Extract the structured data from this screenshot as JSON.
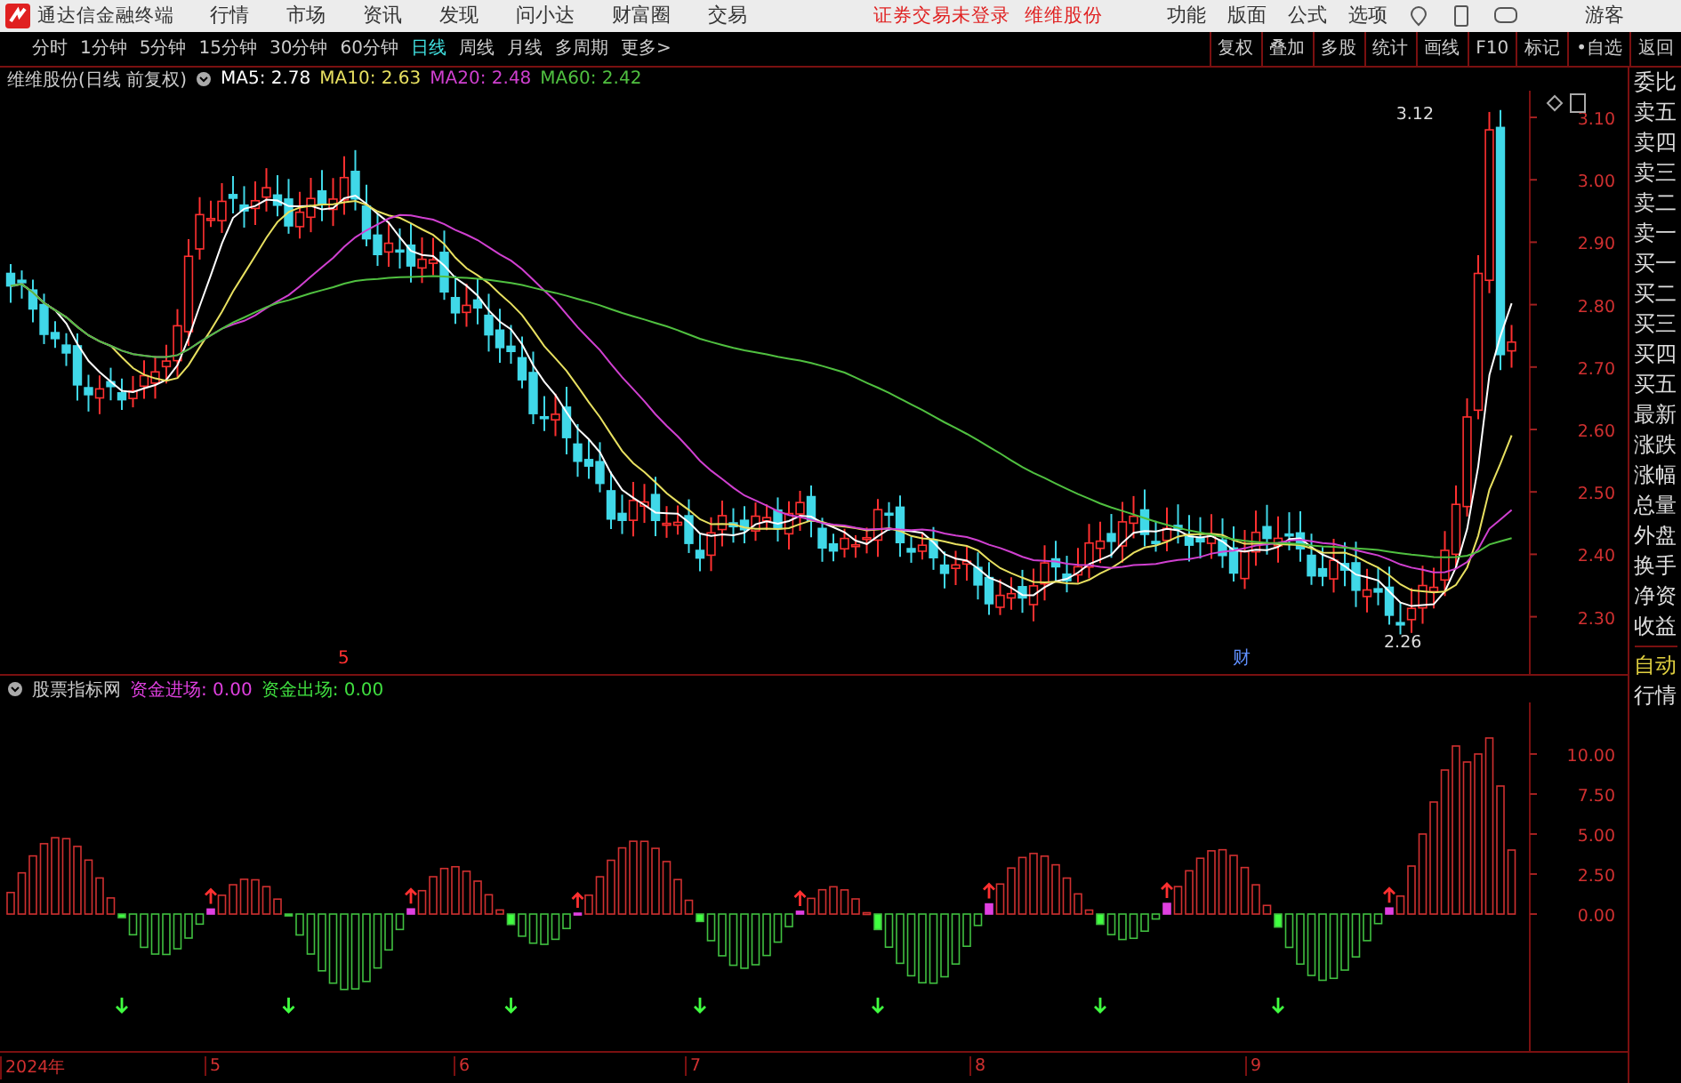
{
  "menu_bar": {
    "app_title": "通达信金融终端",
    "menus": [
      "行情",
      "市场",
      "资讯",
      "发现",
      "问小达",
      "财富圈",
      "交易"
    ],
    "notice": "证券交易未登录",
    "stock": "维维股份",
    "right_menus": [
      "功能",
      "版面",
      "公式",
      "选项"
    ],
    "user": "游客"
  },
  "toolbar": {
    "periods": [
      {
        "label": "分时",
        "selected": false
      },
      {
        "label": "1分钟",
        "selected": false
      },
      {
        "label": "5分钟",
        "selected": false
      },
      {
        "label": "15分钟",
        "selected": false
      },
      {
        "label": "30分钟",
        "selected": false
      },
      {
        "label": "60分钟",
        "selected": false
      },
      {
        "label": "日线",
        "selected": true
      },
      {
        "label": "周线",
        "selected": false
      },
      {
        "label": "月线",
        "selected": false
      },
      {
        "label": "多周期",
        "selected": false
      },
      {
        "label": "更多>",
        "selected": false
      }
    ],
    "tools": [
      "复权",
      "叠加",
      "多股",
      "统计",
      "画线",
      "F10",
      "标记",
      "•自选",
      "返回"
    ]
  },
  "main_chart": {
    "title": "维维股份(日线 前复权)",
    "ma": [
      {
        "label": "MA5: 2.78",
        "color": "#ffffff"
      },
      {
        "label": "MA10: 2.63",
        "color": "#e8e060"
      },
      {
        "label": "MA20: 2.48",
        "color": "#d040d0"
      },
      {
        "label": "MA60: 2.42",
        "color": "#50c040"
      }
    ],
    "price_ticks": [
      "3.10",
      "3.00",
      "2.90",
      "2.80",
      "2.70",
      "2.60",
      "2.50",
      "2.40",
      "2.30"
    ],
    "high_label": "3.12",
    "low_label": "2.26",
    "markers": [
      {
        "label": "5",
        "kind": "split"
      },
      {
        "label": "财",
        "kind": "report"
      }
    ]
  },
  "indicator": {
    "title": "股票指标网",
    "series": [
      {
        "label": "资金进场: 0.00",
        "color": "#e040e0"
      },
      {
        "label": "资金出场: 0.00",
        "color": "#40e040"
      }
    ],
    "ticks": [
      "10.00",
      "7.50",
      "5.00",
      "2.50",
      "0.00"
    ]
  },
  "date_axis": [
    "2024年",
    "5",
    "6",
    "7",
    "8",
    "9"
  ],
  "side_panel": {
    "quote_labels": [
      "委比",
      "卖五",
      "卖四",
      "卖三",
      "卖二",
      "卖一",
      "买一",
      "买二",
      "买三",
      "买四",
      "买五",
      "最新",
      "涨跌",
      "涨幅",
      "总量",
      "外盘",
      "换手",
      "净资",
      "收益"
    ],
    "auto_labels": [
      "自动",
      "行情"
    ]
  }
}
